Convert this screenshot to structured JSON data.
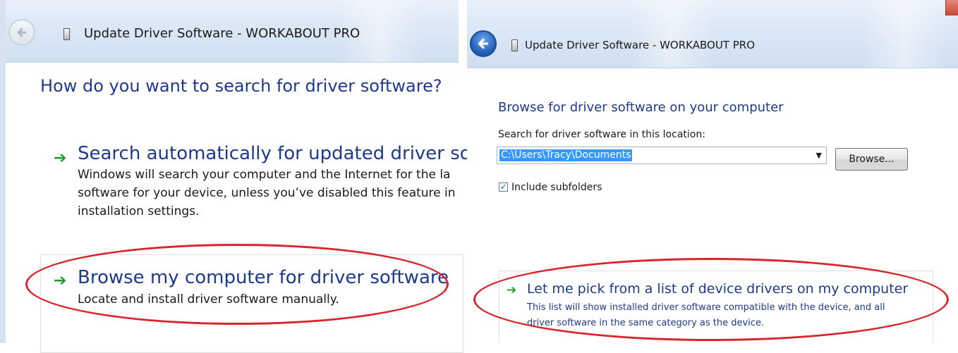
{
  "left_dialog": {
    "title": "Update Driver Software - WORKABOUT PRO",
    "heading": "How do you want to search for driver software?",
    "option_auto": {
      "title": "Search automatically for updated driver softwa",
      "description": "Windows will search your computer and the Internet for the la\nsoftware for your device, unless you’ve disabled this feature in\ninstallation settings."
    },
    "option_browse": {
      "title": "Browse my computer for driver software",
      "description": "Locate and install driver software manually."
    }
  },
  "right_dialog": {
    "title": "Update Driver Software - WORKABOUT PRO",
    "heading": "Browse for driver software on your computer",
    "search_label": "Search for driver software in this location:",
    "path_value": "C:\\Users\\Tracy\\Documents",
    "browse_label": "Browse...",
    "include_subfolders_label": "Include subfolders",
    "include_subfolders_checked": true,
    "option_pick": {
      "title": "Let me pick from a list of device drivers on my computer",
      "description": "This list will show installed driver software compatible with the device, and all\ndriver software in the same category as the device."
    }
  },
  "icons": {
    "back": "back-arrow-icon",
    "device": "device-icon",
    "option_arrow": "green-arrow-icon",
    "dropdown": "chevron-down-icon",
    "check": "checkmark-icon"
  },
  "colors": {
    "heading": "#1e3a8c",
    "arrow": "#1f9a2b",
    "annotation": "#d8262c",
    "selection": "#3399ff"
  }
}
